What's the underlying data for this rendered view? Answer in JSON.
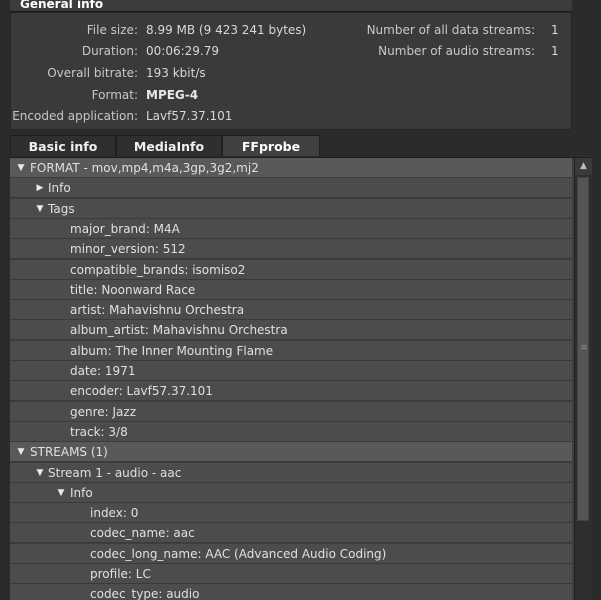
{
  "general_info": {
    "title": "General info",
    "left": [
      {
        "label": "File size:",
        "value": "8.99 MB (9 423 241 bytes)",
        "bold": false
      },
      {
        "label": "Duration:",
        "value": "00:06:29.79",
        "bold": false
      },
      {
        "label": "Overall bitrate:",
        "value": "193 kbit/s",
        "bold": false
      },
      {
        "label": "Format:",
        "value": "MPEG-4",
        "bold": true
      },
      {
        "label": "Encoded application:",
        "value": "Lavf57.37.101",
        "bold": false
      }
    ],
    "right": [
      {
        "label": "Number of all data streams:",
        "value": "1"
      },
      {
        "label": "Number of audio streams:",
        "value": "1"
      }
    ]
  },
  "tabs": [
    {
      "label": "Basic info",
      "active": false
    },
    {
      "label": "MediaInfo",
      "active": false
    },
    {
      "label": "FFprobe",
      "active": true
    }
  ],
  "tree": [
    {
      "text": "FORMAT - mov,mp4,m4a,3gp,3g2,mj2",
      "level": 0,
      "arrow": "down",
      "section": true
    },
    {
      "text": "Info",
      "level": 1,
      "arrow": "right",
      "section": false
    },
    {
      "text": "Tags",
      "level": 1,
      "arrow": "down",
      "section": false
    },
    {
      "text": "major_brand: M4A",
      "level": 2,
      "arrow": "",
      "section": false
    },
    {
      "text": "minor_version: 512",
      "level": 2,
      "arrow": "",
      "section": false
    },
    {
      "text": "compatible_brands: isomiso2",
      "level": 2,
      "arrow": "",
      "section": false
    },
    {
      "text": "title: Noonward Race",
      "level": 2,
      "arrow": "",
      "section": false
    },
    {
      "text": "artist: Mahavishnu Orchestra",
      "level": 2,
      "arrow": "",
      "section": false
    },
    {
      "text": "album_artist: Mahavishnu Orchestra",
      "level": 2,
      "arrow": "",
      "section": false
    },
    {
      "text": "album: The Inner Mounting Flame",
      "level": 2,
      "arrow": "",
      "section": false
    },
    {
      "text": "date: 1971",
      "level": 2,
      "arrow": "",
      "section": false
    },
    {
      "text": "encoder: Lavf57.37.101",
      "level": 2,
      "arrow": "",
      "section": false
    },
    {
      "text": "genre: Jazz",
      "level": 2,
      "arrow": "",
      "section": false
    },
    {
      "text": "track: 3/8",
      "level": 2,
      "arrow": "",
      "section": false
    },
    {
      "text": "STREAMS (1)",
      "level": 0,
      "arrow": "down",
      "section": true
    },
    {
      "text": "Stream 1 - audio - aac",
      "level": 1,
      "arrow": "down",
      "section": false
    },
    {
      "text": "Info",
      "level": 2,
      "arrow": "down",
      "section": false
    },
    {
      "text": "index: 0",
      "level": 3,
      "arrow": "",
      "section": false
    },
    {
      "text": "codec_name: aac",
      "level": 3,
      "arrow": "",
      "section": false
    },
    {
      "text": "codec_long_name: AAC (Advanced Audio Coding)",
      "level": 3,
      "arrow": "",
      "section": false
    },
    {
      "text": "profile: LC",
      "level": 3,
      "arrow": "",
      "section": false
    },
    {
      "text": "codec_type: audio",
      "level": 3,
      "arrow": "",
      "section": false
    }
  ],
  "colors": {
    "background": "#2b2b2b",
    "row": "#4c4c4c",
    "section_row": "#595959"
  }
}
